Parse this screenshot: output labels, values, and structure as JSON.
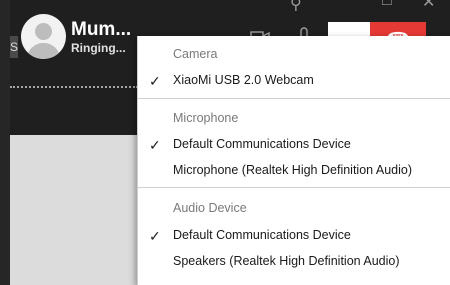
{
  "call": {
    "caller_name": "Mum...",
    "status": "Ringing...",
    "left_edge_text": "S",
    "end_call_icon": "☎",
    "colors": {
      "end_call": "#e53935",
      "window_bg": "#1f1f1f"
    }
  },
  "device_menu": {
    "check_glyph": "✓",
    "camera": {
      "header": "Camera",
      "items": [
        {
          "label": "XiaoMi USB 2.0 Webcam",
          "checked": true
        }
      ]
    },
    "microphone": {
      "header": "Microphone",
      "items": [
        {
          "label": "Default Communications Device",
          "checked": true
        },
        {
          "label": "Microphone (Realtek High Definition Audio)",
          "checked": false
        }
      ]
    },
    "audio_device": {
      "header": "Audio Device",
      "items": [
        {
          "label": "Default Communications Device",
          "checked": true
        },
        {
          "label": "Speakers (Realtek High Definition Audio)",
          "checked": false
        }
      ]
    }
  },
  "icons": [
    "search-icon",
    "minimize-icon",
    "maximize-icon",
    "close-icon",
    "video-camera-icon",
    "microphone-icon",
    "end-call-icon",
    "check-icon"
  ]
}
